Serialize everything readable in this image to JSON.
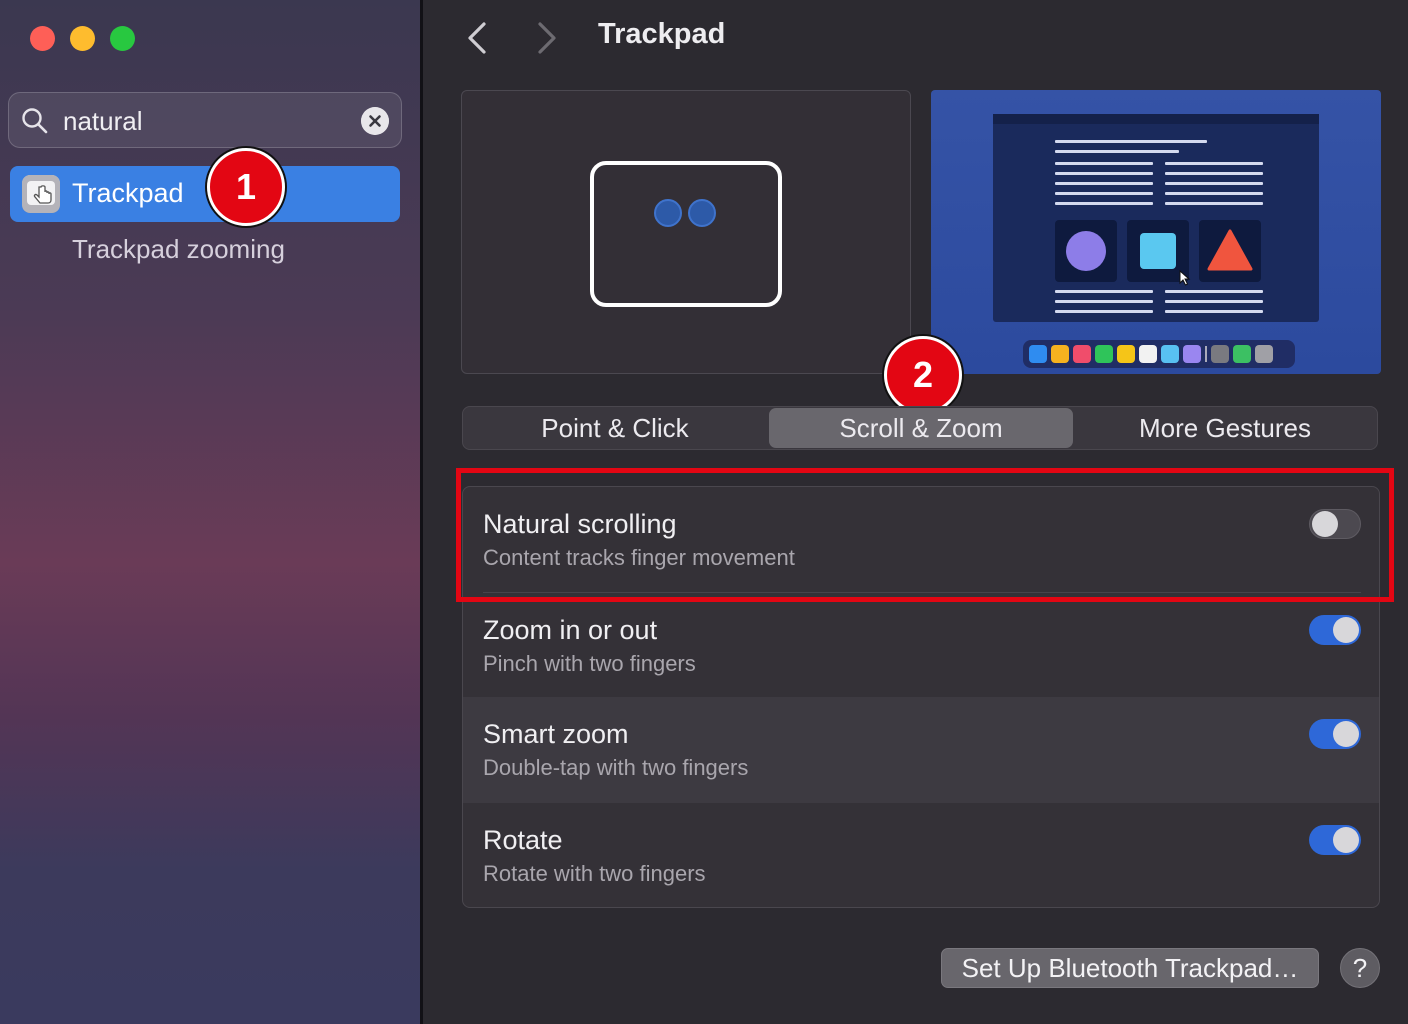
{
  "sidebar": {
    "search": {
      "value": "natural"
    },
    "results": [
      {
        "label": "Trackpad",
        "selected": true
      },
      {
        "label": "Trackpad zooming",
        "selected": false
      }
    ]
  },
  "annotations": {
    "badge1": "1",
    "badge2": "2"
  },
  "header": {
    "title": "Trackpad"
  },
  "tabs": [
    {
      "label": "Point & Click",
      "selected": false
    },
    {
      "label": "Scroll & Zoom",
      "selected": true
    },
    {
      "label": "More Gestures",
      "selected": false
    }
  ],
  "settings": [
    {
      "title": "Natural scrolling",
      "subtitle": "Content tracks finger movement",
      "enabled": false
    },
    {
      "title": "Zoom in or out",
      "subtitle": "Pinch with two fingers",
      "enabled": true
    },
    {
      "title": "Smart zoom",
      "subtitle": "Double-tap with two fingers",
      "enabled": true
    },
    {
      "title": "Rotate",
      "subtitle": "Rotate with two fingers",
      "enabled": true
    }
  ],
  "footer": {
    "setup_label": "Set Up Bluetooth Trackpad…",
    "help_label": "?"
  },
  "colors": {
    "accent": "#2e68d8",
    "selection": "#3a80e3",
    "annotation": "#e30613"
  }
}
